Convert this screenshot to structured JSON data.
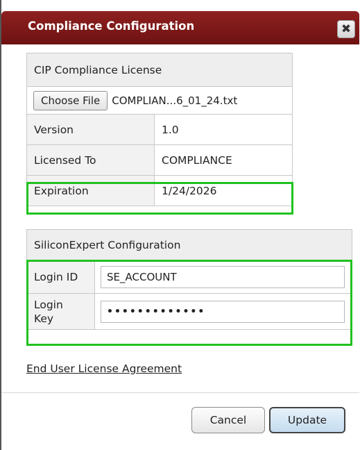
{
  "dialog": {
    "title": "Compliance Configuration",
    "close_label": "✖"
  },
  "license": {
    "header": "CIP Compliance License",
    "choose_file_label": "Choose File",
    "file_name": "COMPLIAN...6_01_24.txt",
    "rows": [
      {
        "label": "Version",
        "value": "1.0"
      },
      {
        "label": "Licensed To",
        "value": "COMPLIANCE"
      },
      {
        "label": "Expiration",
        "value": "1/24/2026"
      }
    ]
  },
  "siliconexpert": {
    "header": "SiliconExpert Configuration",
    "login_id_label": "Login ID",
    "login_id_value": "SE_ACCOUNT",
    "login_key_label": "Login\nKey",
    "login_key_value": "•••••••••••••"
  },
  "footer": {
    "eula_link": "End User License Agreement",
    "cancel_label": "Cancel",
    "update_label": "Update"
  },
  "colors": {
    "titlebar": "#7a1818",
    "highlight": "#1fc21f"
  }
}
